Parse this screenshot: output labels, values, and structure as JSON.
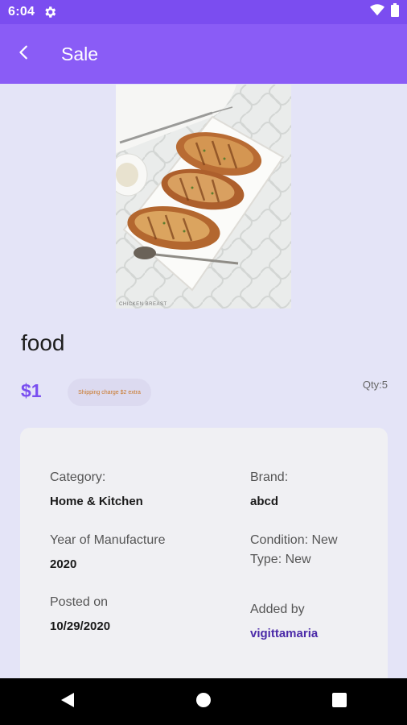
{
  "status_bar": {
    "time": "6:04"
  },
  "app_bar": {
    "title": "Sale"
  },
  "product": {
    "name": "food",
    "price": "$1",
    "shipping_note": "Shipping charge $2 extra",
    "quantity": "Qty:5",
    "image_watermark": "CHICKEN BREAST"
  },
  "details": {
    "category_label": "Category:",
    "category_value": "Home & Kitchen",
    "brand_label": "Brand:",
    "brand_value": "abcd",
    "year_label": "Year of Manufacture",
    "year_value": "2020",
    "condition_label": "Condition: New",
    "type_label": "Type: New",
    "posted_label": "Posted on",
    "posted_value": "10/29/2020",
    "added_label": "Added by",
    "added_value": "vigittamaria"
  },
  "colors": {
    "status_bar": "#7b4df0",
    "app_bar": "#8a5cf6",
    "background": "#e4e4f7",
    "price": "#7a4ff0",
    "link": "#4b2aa8"
  }
}
